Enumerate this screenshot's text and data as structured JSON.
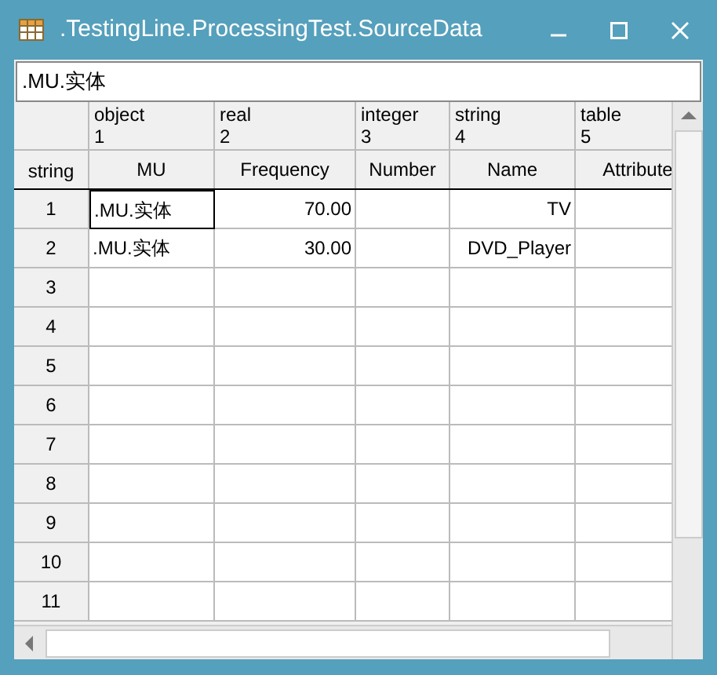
{
  "window": {
    "title": ".TestingLine.ProcessingTest.SourceData"
  },
  "path_field": {
    "value": ".MU.实体"
  },
  "row_header_label": "string",
  "columns": [
    {
      "type": "object",
      "index": "1",
      "name": "MU"
    },
    {
      "type": "real",
      "index": "2",
      "name": "Frequency"
    },
    {
      "type": "integer",
      "index": "3",
      "name": "Number"
    },
    {
      "type": "string",
      "index": "4",
      "name": "Name"
    },
    {
      "type": "table",
      "index": "5",
      "name": "Attribute"
    }
  ],
  "rows": [
    {
      "label": "1",
      "cells": [
        {
          "text": ".MU.实体",
          "selected": true
        },
        {
          "text": "70.00",
          "selected": false
        },
        {
          "selected": false
        },
        {
          "text": "TV",
          "selected": false
        },
        {
          "selected": false
        }
      ]
    },
    {
      "label": "2",
      "cells": [
        {
          "text": ".MU.实体",
          "selected": false
        },
        {
          "text": "30.00",
          "selected": false
        },
        {
          "selected": false
        },
        {
          "text": "DVD_Player",
          "selected": false
        },
        {
          "selected": false
        }
      ]
    },
    {
      "label": "3"
    },
    {
      "label": "4"
    },
    {
      "label": "5"
    },
    {
      "label": "6"
    },
    {
      "label": "7"
    },
    {
      "label": "8"
    },
    {
      "label": "9"
    },
    {
      "label": "10"
    },
    {
      "label": "11"
    }
  ]
}
